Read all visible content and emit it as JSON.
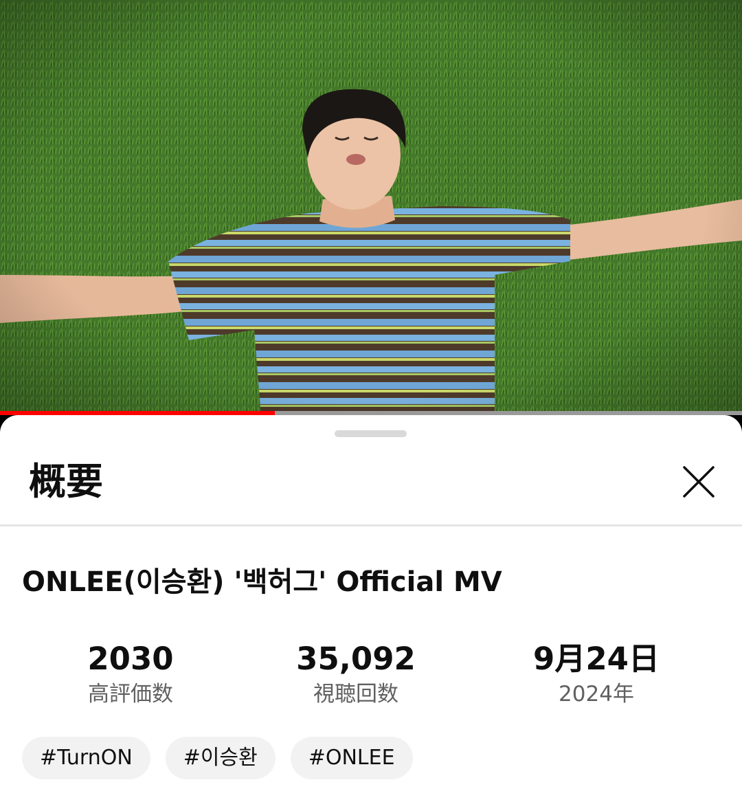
{
  "player": {
    "progress_fraction": 0.37,
    "progress_color": "#ff0000"
  },
  "sheet": {
    "title": "概要",
    "close_icon": "close-icon"
  },
  "video": {
    "title": "ONLEE(이승환) '백허그' Official MV"
  },
  "stats": [
    {
      "value": "2030",
      "label": "高評価数"
    },
    {
      "value": "35,092",
      "label": "視聴回数"
    },
    {
      "value": "9月24日",
      "label": "2024年"
    }
  ],
  "hashtags": [
    "#TurnON",
    "#이승환",
    "#ONLEE"
  ]
}
